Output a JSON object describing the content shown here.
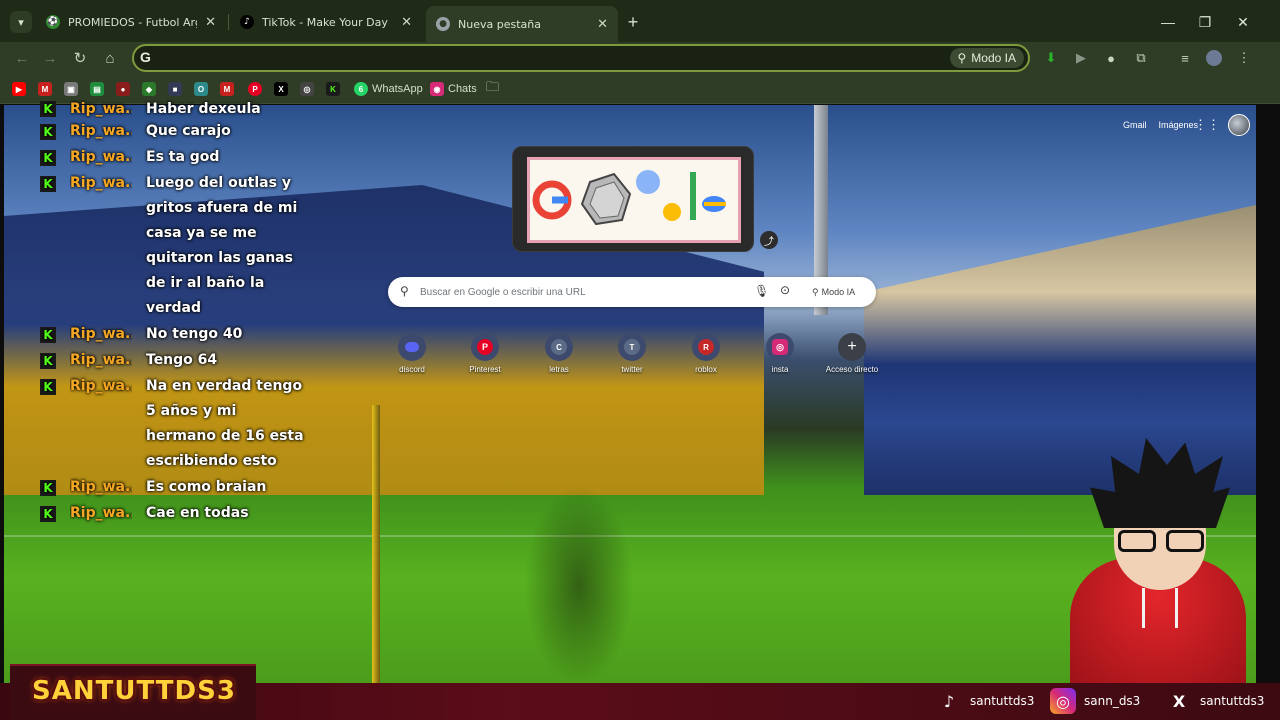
{
  "tabs": [
    {
      "title": "PROMIEDOS - Futbol Argentino",
      "icon": "promiedos-icon",
      "close": "✕",
      "active": false
    },
    {
      "title": "TikTok - Make Your Day",
      "icon": "tiktok-icon",
      "close": "✕",
      "active": false
    },
    {
      "title": "Nueva pestaña",
      "icon": "chrome-icon",
      "close": "✕",
      "active": true
    }
  ],
  "window_controls": {
    "minimize": "—",
    "maximize": "❐",
    "close": "✕"
  },
  "toolbar": {
    "omnibox_g": "G",
    "ai_mode_label": "Modo IA"
  },
  "bookmarks": [
    {
      "label": "",
      "icon": "youtube-icon",
      "color": "#ff0000",
      "glyph": "▶"
    },
    {
      "label": "",
      "icon": "gmail-icon",
      "color": "#c5221f",
      "glyph": "M"
    },
    {
      "label": "",
      "icon": "photos-icon",
      "color": "#7a7a7a",
      "glyph": "▣"
    },
    {
      "label": "",
      "icon": "sheets-icon",
      "color": "#1e8e3e",
      "glyph": "▤"
    },
    {
      "label": "",
      "icon": "site-icon-red",
      "color": "#8a1c1c",
      "glyph": "●"
    },
    {
      "label": "",
      "icon": "github-icon",
      "color": "#2b7a2b",
      "glyph": "◆"
    },
    {
      "label": "",
      "icon": "site-icon-dark",
      "color": "#333a55",
      "glyph": "■"
    },
    {
      "label": "",
      "icon": "opera-icon",
      "color": "#2d8a8a",
      "glyph": "O"
    },
    {
      "label": "",
      "icon": "gmail-icon-2",
      "color": "#c5221f",
      "glyph": "M"
    },
    {
      "label": "",
      "icon": "pinterest-icon",
      "color": "#e60023",
      "glyph": "P"
    },
    {
      "label": "",
      "icon": "x-icon",
      "color": "#000000",
      "glyph": "X"
    },
    {
      "label": "",
      "icon": "chatgpt-icon",
      "color": "#444444",
      "glyph": "◎"
    },
    {
      "label": "",
      "icon": "kick-icon",
      "color": "#1a1a1a",
      "glyph": "K"
    },
    {
      "label": "WhatsApp",
      "icon": "whatsapp-icon",
      "color": "#25d366",
      "glyph": "6"
    },
    {
      "label": "Chats",
      "icon": "instagram-icon",
      "color": "#d62976",
      "glyph": "◉"
    },
    {
      "label": "",
      "icon": "folder-icon",
      "color": "#2f3d26",
      "glyph": "🗀"
    }
  ],
  "ntp": {
    "gmail_link": "Gmail",
    "images_link": "Imágenes",
    "search_placeholder": "Buscar en Google o escribir una URL",
    "ai_mode_label": "Modo IA",
    "shortcuts": [
      {
        "label": "discord",
        "letter": "◉",
        "color": "#5865f2"
      },
      {
        "label": "Pinterest",
        "letter": "P",
        "color": "#e60023"
      },
      {
        "label": "letras",
        "letter": "C",
        "color": "#5b6b86"
      },
      {
        "label": "twitter",
        "letter": "T",
        "color": "#5b6b86"
      },
      {
        "label": "roblox",
        "letter": "R",
        "color": "#c62828"
      },
      {
        "label": "insta",
        "letter": "◎",
        "color": "#d62976"
      },
      {
        "label": "Acceso directo",
        "letter": "+",
        "color": "#3a3f48"
      }
    ]
  },
  "chat": [
    {
      "user": "Rip_wa...",
      "text": "Haber dexeula"
    },
    {
      "user": "Rip_wa...",
      "text": "Que carajo"
    },
    {
      "user": "Rip_wa...",
      "text": "Es ta god"
    },
    {
      "user": "Rip_wa...",
      "text": "Luego del outlas y gritos afuera de mi casa ya se me quitaron las ganas de ir al baño la verdad"
    },
    {
      "user": "Rip_wa...",
      "text": "No tengo 40"
    },
    {
      "user": "Rip_wa...",
      "text": "Tengo 64"
    },
    {
      "user": "Rip_wa...",
      "text": "Na en verdad tengo 5 años y mi hermano de 16 esta escribiendo esto"
    },
    {
      "user": "Rip_wa...",
      "text": "Es como braian"
    },
    {
      "user": "Rip_wa...",
      "text": "Cae en todas"
    }
  ],
  "stream": {
    "logo": "SANTUTTDS3",
    "socials": [
      {
        "handle": "santuttds3",
        "icon": "tiktok-icon"
      },
      {
        "handle": "sann_ds3",
        "icon": "instagram-icon"
      },
      {
        "handle": "santuttds3",
        "icon": "x-icon"
      }
    ]
  }
}
